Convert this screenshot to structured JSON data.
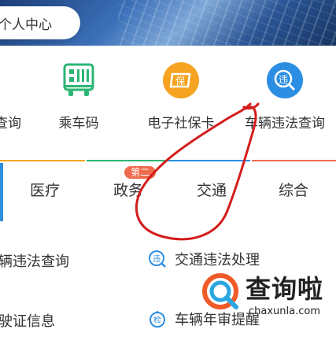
{
  "header": {
    "personal_center": "个人中心"
  },
  "quick_services": [
    {
      "label": "查询",
      "icon": "search-partial"
    },
    {
      "label": "乘车码",
      "icon": "bus-code-icon"
    },
    {
      "label": "电子社保卡",
      "icon": "social-security-card-icon",
      "icon_text": "保",
      "color": "#f5a321"
    },
    {
      "label": "车辆违法查询",
      "icon": "traffic-violation-icon",
      "icon_text": "违",
      "color": "#2b8ee3"
    }
  ],
  "category_tabs": {
    "items": [
      "医疗",
      "政务",
      "交通",
      "综合"
    ],
    "badge": "第二"
  },
  "service_list": [
    {
      "label": "辆违法查询"
    },
    {
      "label": "交通违法处理",
      "icon": "traffic-violation-icon",
      "icon_text": "违"
    },
    {
      "label": "驶证信息"
    },
    {
      "label": "车辆年审提醒",
      "icon": "vehicle-inspection-icon",
      "icon_text": "检"
    }
  ],
  "watermark": {
    "brand": "查询啦",
    "url": "chaxunla.com"
  }
}
